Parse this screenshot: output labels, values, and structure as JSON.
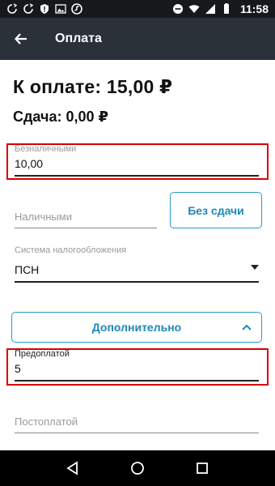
{
  "status_bar": {
    "time": "11:58"
  },
  "app_bar": {
    "title": "Оплата"
  },
  "summary": {
    "to_pay": "К оплате: 15,00 ₽",
    "change": "Сдача: 0,00 ₽"
  },
  "cashless": {
    "label": "Безналичными",
    "value": "10,00"
  },
  "cash": {
    "placeholder": "Наличными"
  },
  "no_change_button": {
    "label": "Без сдачи"
  },
  "tax_system": {
    "label": "Система налогообложения",
    "value": "ПСН"
  },
  "additional_button": {
    "label": "Дополнительно"
  },
  "prepayment": {
    "label": "Предоплатой",
    "value": "5"
  },
  "postpayment": {
    "placeholder": "Постоплатой"
  },
  "colors": {
    "app_bar": "#2a3138",
    "accent": "#1e88b8",
    "highlight": "#d80000"
  }
}
